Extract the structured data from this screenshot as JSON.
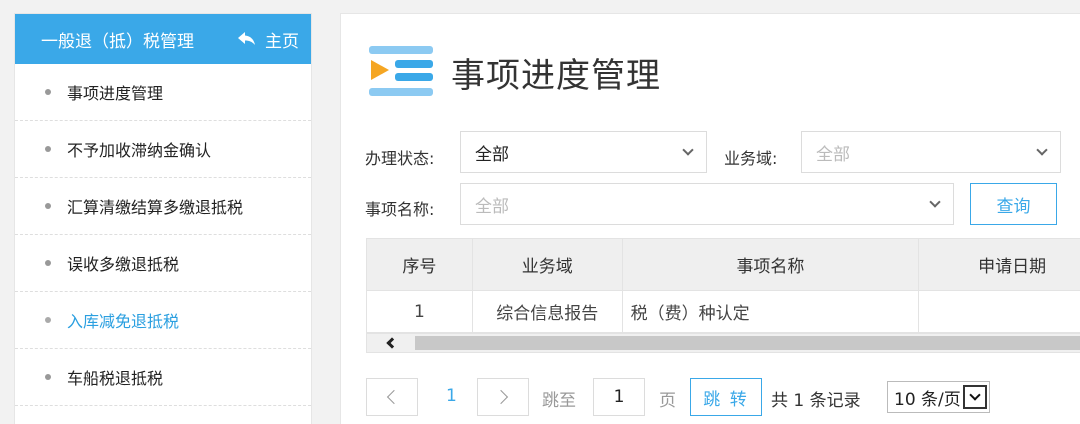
{
  "sidebar": {
    "title": "一般退（抵）税管理",
    "home_label": "主页",
    "items": [
      {
        "label": "事项进度管理"
      },
      {
        "label": "不予加收滞纳金确认"
      },
      {
        "label": "汇算清缴结算多缴退抵税"
      },
      {
        "label": "误收多缴退抵税"
      },
      {
        "label": "入库减免退抵税"
      },
      {
        "label": "车船税退抵税"
      }
    ],
    "active_index": 4
  },
  "main": {
    "title": "事项进度管理",
    "filters": {
      "status_label": "办理状态:",
      "status_value": "全部",
      "domain_label": "业务域:",
      "domain_placeholder": "全部",
      "item_label": "事项名称:",
      "item_placeholder": "全部",
      "query_button": "查询"
    },
    "table": {
      "headers": [
        "序号",
        "业务域",
        "事项名称",
        "申请日期"
      ],
      "rows": [
        {
          "no": "1",
          "domain": "综合信息报告",
          "name": "税（费）种认定",
          "date": ""
        }
      ]
    },
    "pagination": {
      "current_page": "1",
      "jump_label": "跳至",
      "jump_value": "1",
      "page_unit": "页",
      "go_button": "跳 转",
      "total_text": "共 1 条记录",
      "page_size": "10 条/页"
    }
  },
  "colors": {
    "accent": "#3aa8e8",
    "icon_orange": "#f5a623",
    "icon_blue": "#3aa8e8"
  }
}
